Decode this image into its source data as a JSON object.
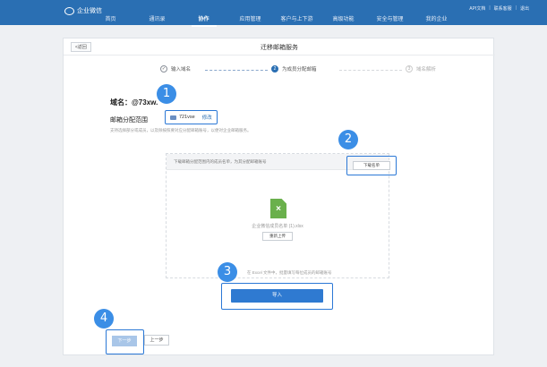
{
  "topbar": {
    "app_name": "企业微信",
    "links": [
      "API文档",
      "联系客服",
      "退出"
    ]
  },
  "nav": {
    "items": [
      {
        "label": "首页",
        "active": false
      },
      {
        "label": "通讯录",
        "active": false
      },
      {
        "label": "协作",
        "active": true
      },
      {
        "label": "应用管理",
        "active": false
      },
      {
        "label": "客户与上下游",
        "active": false
      },
      {
        "label": "高级功能",
        "active": false
      },
      {
        "label": "安全与管理",
        "active": false
      },
      {
        "label": "我的企业",
        "active": false
      }
    ]
  },
  "panel": {
    "back_label": "<返回",
    "title": "迁移邮箱服务"
  },
  "steps": [
    {
      "number": "✓",
      "label": "输入域名",
      "state": "done"
    },
    {
      "number": "2",
      "label": "为成员分配邮箱",
      "state": "current"
    },
    {
      "number": "3",
      "label": "域名解析",
      "state": "pending"
    }
  ],
  "form": {
    "domain_label": "域名：@73xw.",
    "range_label": "邮箱分配范围",
    "range_value": "721vse",
    "edit_label": "修改",
    "hint": "支持选择部分或成员，以及除按照要对应分配邮箱账号，以便对企业邮箱服务。"
  },
  "upload": {
    "bar_text": "下载邮箱分配范围内的成员名单，为其分配邮箱账号",
    "download_label": "下载名单",
    "file_name": "企业微信成员名单 (1).xlsx",
    "reupload_label": "重新上传",
    "tip": "在 Excel 文件中，批量填写每位成员的邮箱账号"
  },
  "actions": {
    "import_label": "导入",
    "next_label": "下一步",
    "prev_label": "上一步"
  },
  "badges": [
    "1",
    "2",
    "3",
    "4"
  ],
  "colors": {
    "brand": "#2a6fb3",
    "highlight": "#2b78d6",
    "badge": "#3b8ee6",
    "excel": "#6ab04c"
  }
}
